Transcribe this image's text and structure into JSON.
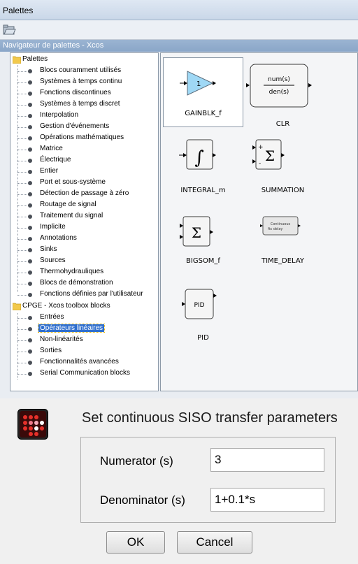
{
  "window": {
    "title": "Palettes"
  },
  "navigator": {
    "title": "Navigateur de palettes - Xcos"
  },
  "tree": {
    "palettes_root": "Palettes",
    "palettes": [
      "Blocs couramment utilisés",
      "Systèmes à temps continu",
      "Fonctions discontinues",
      "Systèmes à temps discret",
      "Interpolation",
      "Gestion d'événements",
      "Opérations mathématiques",
      "Matrice",
      "Électrique",
      "Entier",
      "Port et sous-système",
      "Détection de passage à zéro",
      "Routage de signal",
      "Traitement du signal",
      "Implicite",
      "Annotations",
      "Sinks",
      "Sources",
      "Thermohydrauliques",
      "Blocs de démonstration",
      "Fonctions définies par l'utilisateur"
    ],
    "cpge_root": "CPGE - Xcos toolbox blocks",
    "cpge": [
      "Entrées",
      "Opérateurs linéaires",
      "Non-linéarités",
      "Sorties",
      "Fonctionnalités avancées",
      "Serial Communication blocks"
    ],
    "selected": "Opérateurs linéaires"
  },
  "blocks": [
    {
      "name": "GAINBLK_f",
      "glyph": "1"
    },
    {
      "name": "CLR",
      "glyph_num": "num(s)",
      "glyph_den": "den(s)"
    },
    {
      "name": "INTEGRAL_m",
      "glyph": "∫"
    },
    {
      "name": "SUMMATION",
      "glyph": "Σ",
      "plus": "+",
      "minus": "-"
    },
    {
      "name": "BIGSOM_f",
      "glyph": "Σ"
    },
    {
      "name": "TIME_DELAY",
      "glyph_line1": "Continuous",
      "glyph_line2": "fix delay"
    },
    {
      "name": "PID",
      "glyph": "PID"
    }
  ],
  "dialog": {
    "title": "Set continuous SISO transfer parameters",
    "numerator_label": "Numerator (s)",
    "numerator_value": "3",
    "denominator_label": "Denominator (s)",
    "denominator_value": "1+0.1*s",
    "ok_label": "OK",
    "cancel_label": "Cancel"
  },
  "colors": {
    "selection": "#2f6fcf",
    "gain_fill": "#9fd8f5",
    "folder": "#f2c94c"
  },
  "icons": [
    "folder-open-icon",
    "folder-icon",
    "bullet-icon",
    "scilab-dialog-icon"
  ]
}
